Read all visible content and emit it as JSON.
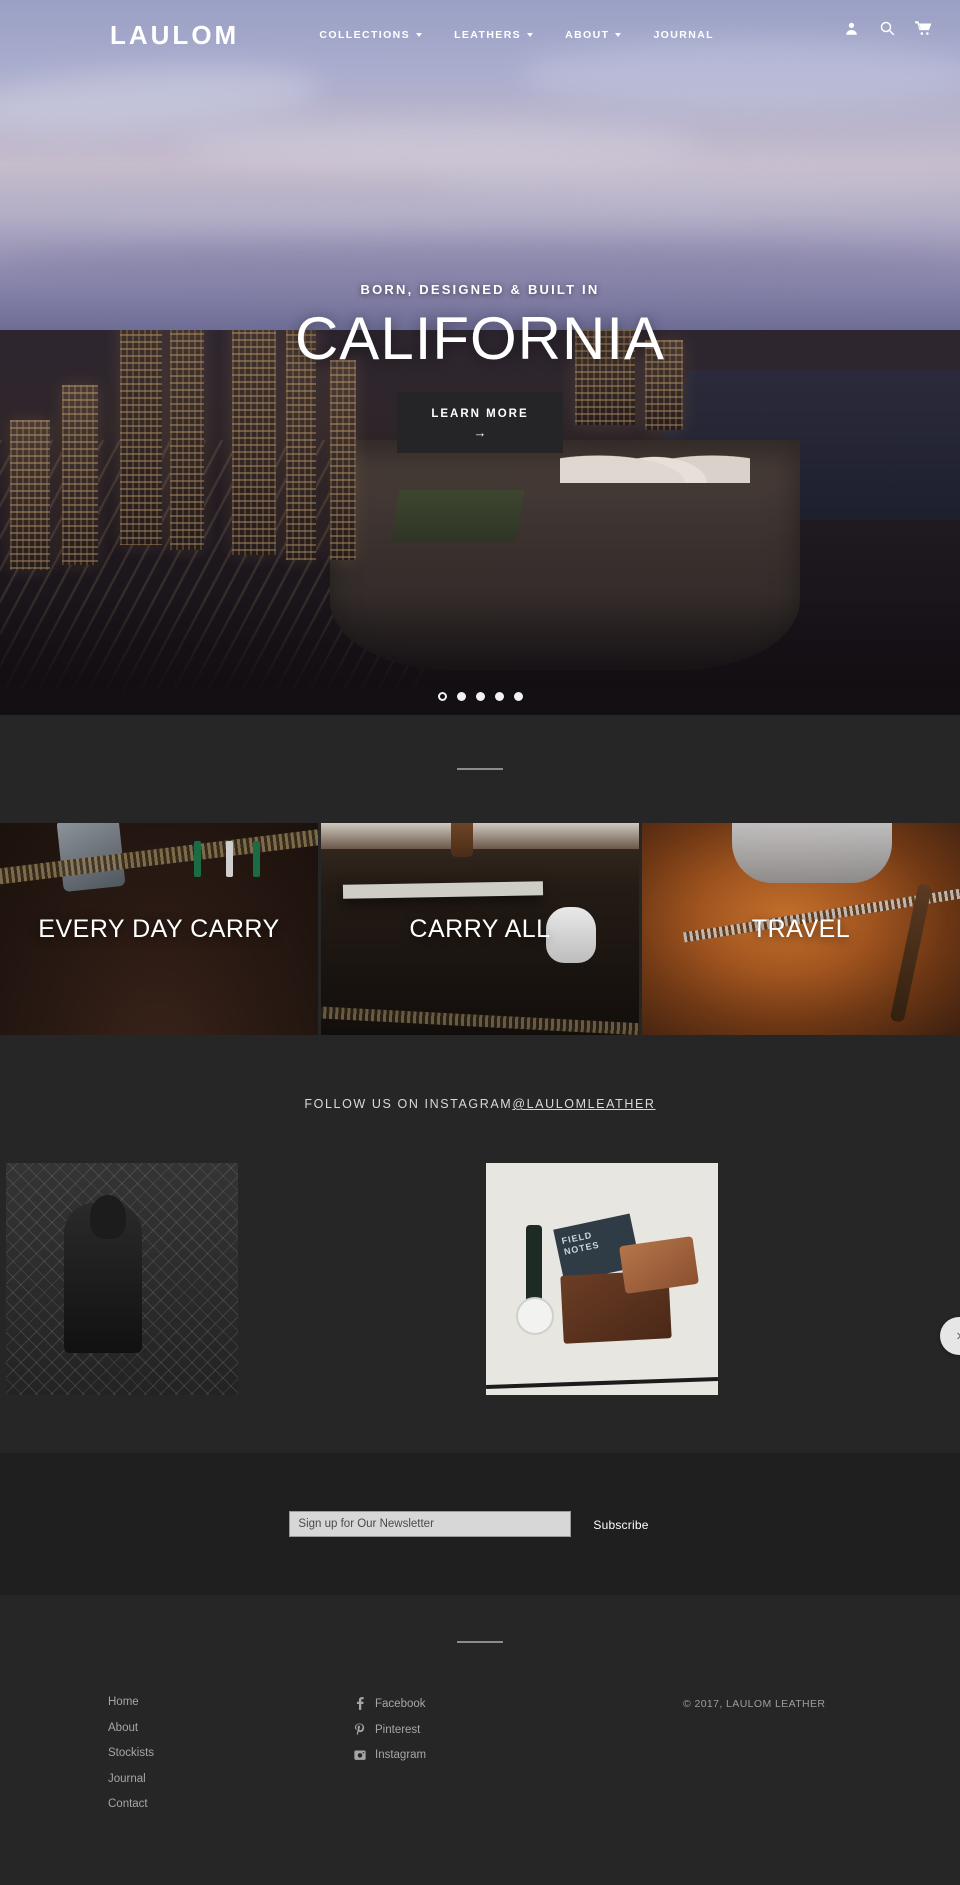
{
  "brand": {
    "logo_text": "LAULOM"
  },
  "header": {
    "nav": [
      {
        "label": "COLLECTIONS",
        "has_dropdown": true
      },
      {
        "label": "LEATHERS",
        "has_dropdown": true
      },
      {
        "label": "ABOUT",
        "has_dropdown": true
      },
      {
        "label": "JOURNAL",
        "has_dropdown": false
      }
    ],
    "icons": [
      {
        "name": "account-icon",
        "glyph": "person"
      },
      {
        "name": "search-icon",
        "glyph": "magnifier"
      },
      {
        "name": "cart-icon",
        "glyph": "shopping-cart"
      }
    ]
  },
  "hero": {
    "kicker": "BORN, DESIGNED & BUILT IN",
    "title": "CALIFORNIA",
    "button_label": "LEARN MORE",
    "button_arrow": "→",
    "slide_count": 5,
    "active_slide": 1
  },
  "categories": [
    {
      "label": "EVERY DAY CARRY"
    },
    {
      "label": "CARRY ALL"
    },
    {
      "label": "TRAVEL"
    }
  ],
  "instagram": {
    "heading": "FOLLOW US ON INSTAGRAM",
    "handle": "@LAULOMLEATHER",
    "next_arrow": "›",
    "posts": [
      {
        "alt": "person-with-backpack-at-fence"
      },
      {
        "alt": "watch-field-notes-and-leather-wallets"
      }
    ],
    "notes_text": "FIELD NOTES"
  },
  "newsletter": {
    "placeholder": "Sign up for Our Newsletter",
    "submit_label": "Subscribe"
  },
  "footer": {
    "links": [
      {
        "label": "Home"
      },
      {
        "label": "About"
      },
      {
        "label": "Stockists"
      },
      {
        "label": "Journal"
      },
      {
        "label": "Contact"
      }
    ],
    "social": [
      {
        "label": "Facebook",
        "icon": "facebook-icon",
        "glyph": "f"
      },
      {
        "label": "Pinterest",
        "icon": "pinterest-icon",
        "glyph": "P"
      },
      {
        "label": "Instagram",
        "icon": "instagram-icon",
        "glyph": "▣"
      }
    ],
    "copyright": "© 2017,   LAULOM LEATHER"
  },
  "colors": {
    "page_bg": "#262626",
    "newsletter_bg": "#1f1f1f",
    "text_light": "#e8e8e8",
    "muted": "#a6a6a6",
    "button_dark": "#252527"
  }
}
